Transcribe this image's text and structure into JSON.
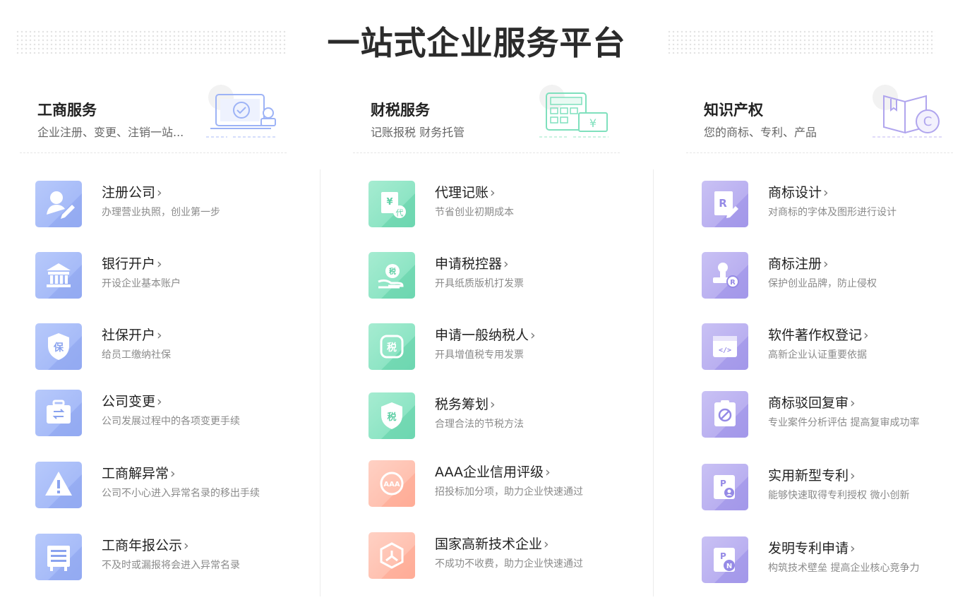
{
  "header": {
    "title": "一站式企业服务平台"
  },
  "colors": {
    "blue": "#9db3f6",
    "green": "#7fe0bd",
    "peach": "#ffb7a4",
    "purple": "#b0a5ee"
  },
  "columns": [
    {
      "title": "工商服务",
      "subtitle": "企业注册、变更、注销一站...",
      "illustration": "laptop-check-stamp-icon",
      "items": [
        {
          "name": "注册公司",
          "desc": "办理营业执照，创业第一步",
          "icon": "person-pen-icon"
        },
        {
          "name": "银行开户",
          "desc": "开设企业基本账户",
          "icon": "bank-icon"
        },
        {
          "name": "社保开户",
          "desc": "给员工缴纳社保",
          "icon": "shield-bao-icon"
        },
        {
          "name": "公司变更",
          "desc": "公司发展过程中的各项变更手续",
          "icon": "briefcase-swap-icon"
        },
        {
          "name": "工商解异常",
          "desc": "公司不小心进入异常名录的移出手续",
          "icon": "warning-icon"
        },
        {
          "name": "工商年报公示",
          "desc": "不及时或漏报将会进入异常名录",
          "icon": "report-board-icon"
        }
      ]
    },
    {
      "title": "财税服务",
      "subtitle": "记账报税 财务托管",
      "illustration": "calculator-yuan-icon",
      "items": [
        {
          "name": "代理记账",
          "desc": "节省创业初期成本",
          "icon": "yuan-doc-dai-icon"
        },
        {
          "name": "申请税控器",
          "desc": "开具纸质版机打发票",
          "icon": "hand-tax-coin-icon"
        },
        {
          "name": "申请一般纳税人",
          "desc": "开具增值税专用发票",
          "icon": "tax-stamp-icon"
        },
        {
          "name": "税务筹划",
          "desc": "合理合法的节税方法",
          "icon": "shield-tax-icon"
        },
        {
          "name": "AAA企业信用评级",
          "desc": "招投标加分项，助力企业快速通过",
          "icon": "aaa-badge-icon"
        },
        {
          "name": "国家高新技术企业",
          "desc": "不成功不收费，助力企业快速通过",
          "icon": "hexagon-tech-icon"
        }
      ]
    },
    {
      "title": "知识产权",
      "subtitle": "您的商标、专利、产品",
      "illustration": "book-copyright-icon",
      "items": [
        {
          "name": "商标设计",
          "desc": "对商标的字体及图形进行设计",
          "icon": "registered-doc-pen-icon"
        },
        {
          "name": "商标注册",
          "desc": "保护创业品牌，防止侵权",
          "icon": "stamp-registered-icon"
        },
        {
          "name": "软件著作权登记",
          "desc": "高新企业认证重要依据",
          "icon": "code-window-icon"
        },
        {
          "name": "商标驳回复审",
          "desc": "专业案件分析评估 提高复审成功率",
          "icon": "clipboard-forbidden-icon"
        },
        {
          "name": "实用新型专利",
          "desc": "能够快速取得专利授权 微小创新",
          "icon": "patent-person-icon"
        },
        {
          "name": "发明专利申请",
          "desc": "构筑技术壁垒 提高企业核心竞争力",
          "icon": "patent-n-icon"
        }
      ]
    }
  ]
}
